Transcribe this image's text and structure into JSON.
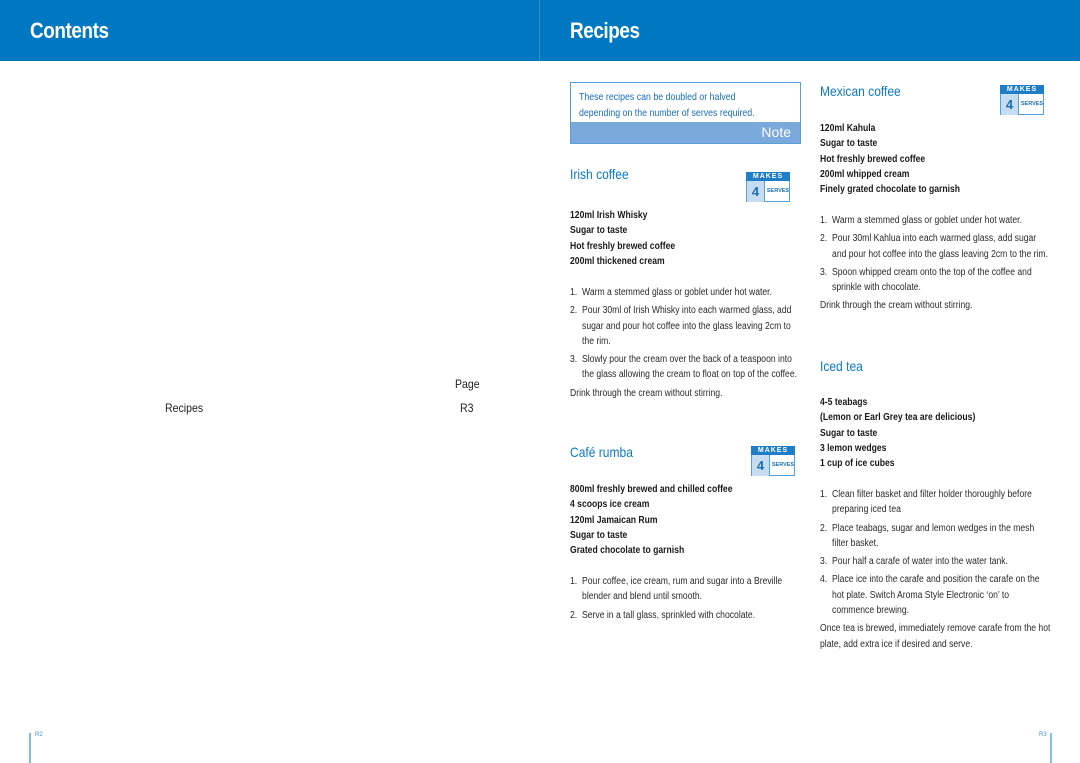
{
  "header": {
    "left_title": "Contents",
    "right_title": "Recipes",
    "band_color": "#0078c1"
  },
  "contents": {
    "page_column_label": "Page",
    "entries": [
      {
        "label": "Recipes",
        "page": "R3"
      }
    ]
  },
  "note": {
    "text_line1": "These recipes can be doubled or halved",
    "text_line2": "depending on the number of serves required.",
    "label": "Note"
  },
  "makes_badge": {
    "top_label": "MAKES",
    "unit_label": "SERVES"
  },
  "recipes": [
    {
      "title": "Irish coffee",
      "serves": "4",
      "ingredients": [
        "120ml Irish Whisky",
        "Sugar to taste",
        "Hot freshly brewed coffee",
        "200ml thickened cream"
      ],
      "steps": [
        "Warm a stemmed glass or goblet under hot water.",
        "Pour 30ml of Irish Whisky into each warmed glass, add sugar and pour hot coffee into the glass leaving 2cm to the rim.",
        "Slowly pour the cream over the back of a teaspoon into the glass allowing the cream to float on top of the coffee."
      ],
      "closing": "Drink through the cream without stirring."
    },
    {
      "title": "Café rumba",
      "serves": "4",
      "ingredients": [
        "800ml freshly brewed and chilled coffee",
        "4 scoops ice cream",
        "120ml Jamaican Rum",
        "Sugar to taste",
        "Grated chocolate to garnish"
      ],
      "steps": [
        "Pour coffee, ice cream, rum and sugar into a Breville blender and blend until smooth.",
        "Serve in a tall glass, sprinkled with chocolate."
      ],
      "closing": ""
    },
    {
      "title": "Mexican coffee",
      "serves": "4",
      "ingredients": [
        "120ml Kahula",
        "Sugar to taste",
        "Hot freshly brewed coffee",
        "200ml whipped cream",
        "Finely grated chocolate to garnish"
      ],
      "steps": [
        "Warm a stemmed glass or goblet under hot water.",
        "Pour 30ml Kahlua into each warmed glass, add sugar and pour hot coffee into the glass leaving 2cm to the rim.",
        "Spoon whipped cream onto the top of the coffee and sprinkle with chocolate."
      ],
      "closing": "Drink through the cream without stirring."
    },
    {
      "title": "Iced tea",
      "ingredients": [
        "4-5 teabags",
        "(Lemon or Earl Grey tea are delicious)",
        "Sugar to taste",
        "3 lemon wedges",
        "1 cup of ice cubes"
      ],
      "steps": [
        "Clean filter basket and filter holder thoroughly before preparing iced tea",
        "Place teabags, sugar and lemon wedges in the mesh filter basket.",
        "Pour half a carafe of water into the water tank.",
        "Place ice into the carafe and position the carafe on the hot plate. Switch Aroma Style Electronic ‘on’ to commence brewing."
      ],
      "closing": "Once tea is brewed, immediately remove carafe from the hot plate, add extra ice if desired and serve."
    }
  ],
  "footer": {
    "left_folio": "R2",
    "right_folio": "R3"
  }
}
